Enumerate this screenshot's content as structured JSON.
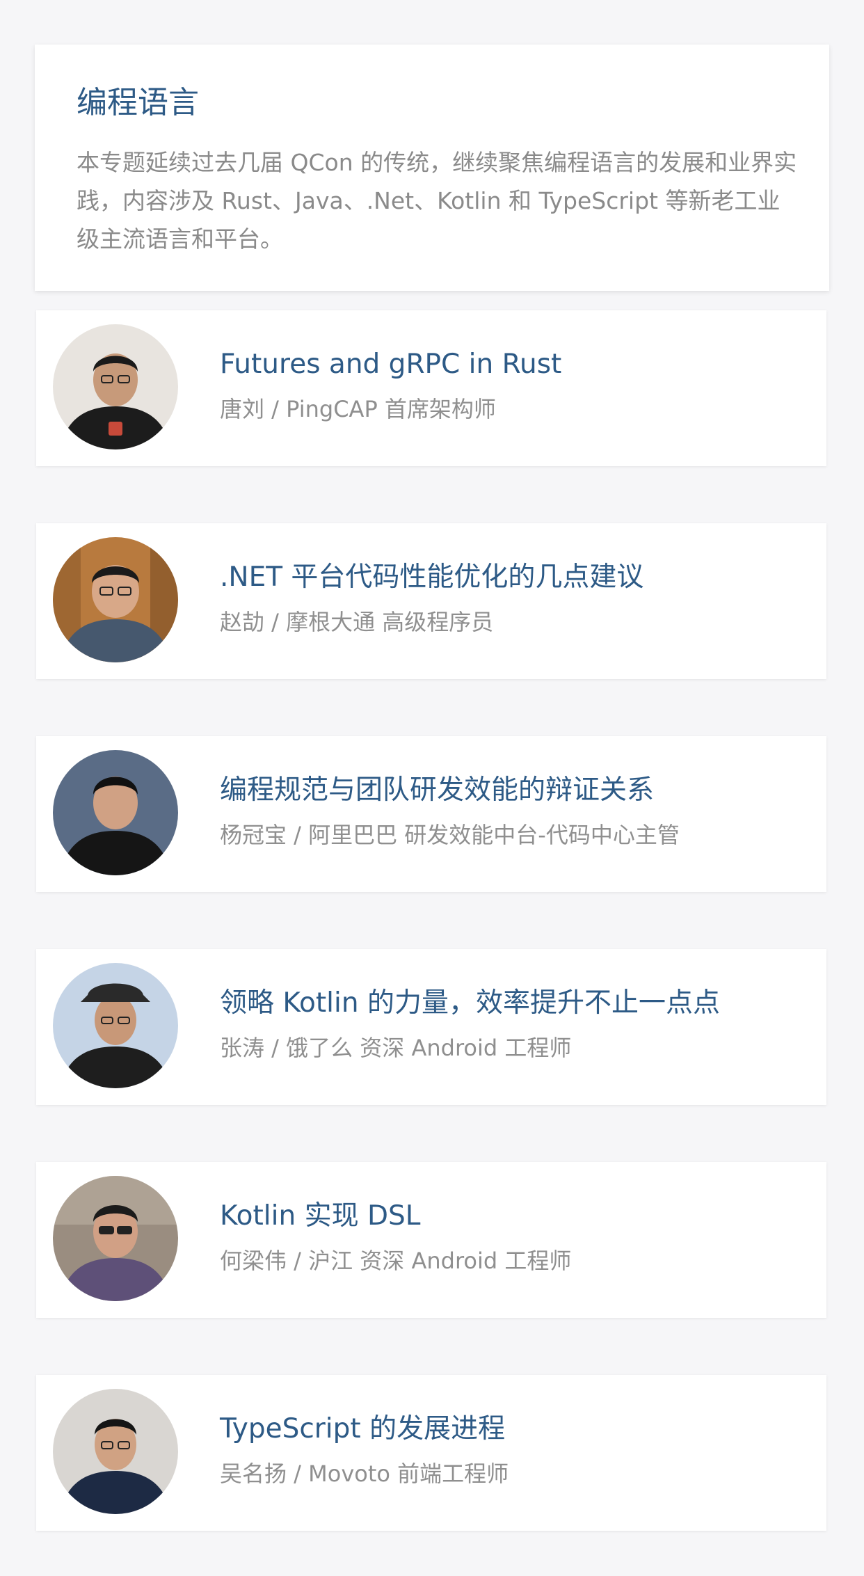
{
  "topic": {
    "title": "编程语言",
    "description": "本专题延续过去几届 QCon 的传统，继续聚焦编程语言的发展和业界实践，内容涉及 Rust、Java、.Net、Kotlin 和 TypeScript 等新老工业级主流语言和平台。"
  },
  "talks": [
    {
      "title": "Futures and gRPC in Rust",
      "speaker": "唐刘 / PingCAP 首席架构师",
      "avatar_colors": {
        "bg": "#e8e4df",
        "shirt": "#1c1c1c",
        "skin": "#c79a7a",
        "hair": "#1a1a1a"
      }
    },
    {
      "title": ".NET 平台代码性能优化的几点建议",
      "speaker": "赵劼 / 摩根大通 高级程序员",
      "avatar_colors": {
        "bg": "#b87a3e",
        "shirt": "#46586e",
        "skin": "#d8a888",
        "hair": "#1a1a1a"
      }
    },
    {
      "title": "编程规范与团队研发效能的辩证关系",
      "speaker": "杨冠宝 / 阿里巴巴 研发效能中台-代码中心主管",
      "avatar_colors": {
        "bg": "#5a6c86",
        "shirt": "#151515",
        "skin": "#d0a184",
        "hair": "#111111"
      }
    },
    {
      "title": "领略 Kotlin 的力量，效率提升不止一点点",
      "speaker": "张涛 / 饿了么 资深 Android 工程师",
      "avatar_colors": {
        "bg": "#c5d4e6",
        "shirt": "#1e1e1e",
        "skin": "#c89878",
        "hair": "#2a2a2a"
      }
    },
    {
      "title": "Kotlin 实现 DSL",
      "speaker": "何梁伟 / 沪江 资深 Android 工程师",
      "avatar_colors": {
        "bg": "#9a8d80",
        "shirt": "#5e5078",
        "skin": "#d1a085",
        "hair": "#1b1b1b"
      }
    },
    {
      "title": "TypeScript 的发展进程",
      "speaker": "吴名扬 / Movoto 前端工程师",
      "avatar_colors": {
        "bg": "#d9d6d2",
        "shirt": "#1d2a44",
        "skin": "#d0a283",
        "hair": "#151515"
      }
    }
  ]
}
